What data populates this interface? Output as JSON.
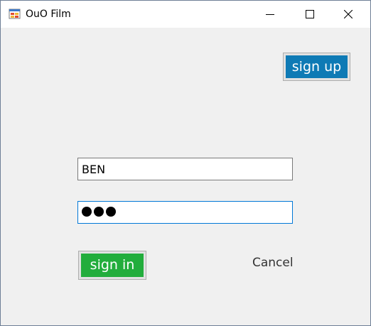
{
  "window": {
    "title": "OuO Film",
    "icon": "app-form-icon",
    "controls": {
      "minimize_icon": "minimize-icon",
      "maximize_icon": "maximize-icon",
      "close_icon": "close-icon"
    }
  },
  "actions": {
    "signup_label": "sign up",
    "signin_label": "sign in",
    "cancel_label": "Cancel"
  },
  "form": {
    "username_value": "BEN",
    "password_mask_count": 3
  },
  "colors": {
    "signup_bg": "#0e7ab5",
    "signin_bg": "#22ad3c",
    "form_bg": "#f0f0f0",
    "focus_border": "#0078d7"
  }
}
